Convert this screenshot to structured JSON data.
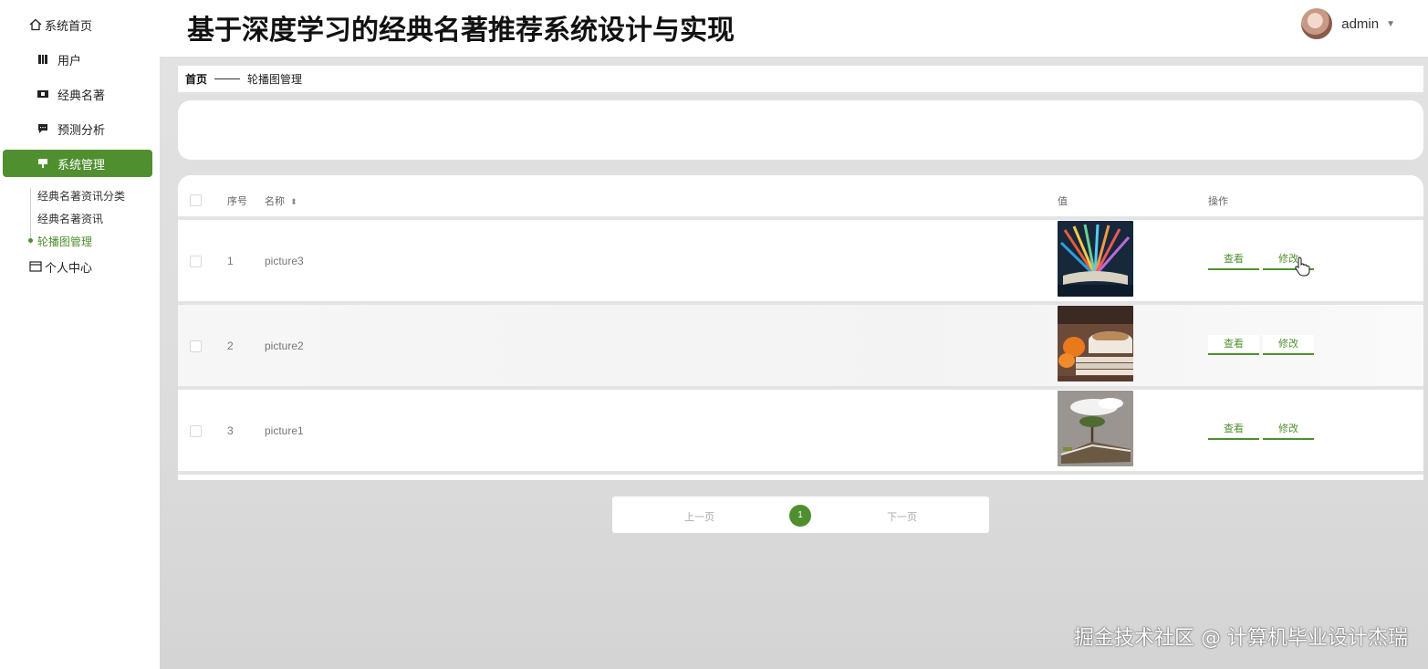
{
  "app_title": "基于深度学习的经典名著推荐系统设计与实现",
  "user": {
    "name": "admin"
  },
  "sidebar": {
    "items": [
      {
        "label": "系统首页",
        "icon": "home-icon"
      },
      {
        "label": "用户",
        "icon": "user-icon"
      },
      {
        "label": "经典名著",
        "icon": "book-icon"
      },
      {
        "label": "预测分析",
        "icon": "chart-icon"
      },
      {
        "label": "系统管理",
        "icon": "settings-icon",
        "active": true
      },
      {
        "label": "个人中心",
        "icon": "profile-icon"
      }
    ],
    "submenu": [
      {
        "label": "经典名著资讯分类"
      },
      {
        "label": "经典名著资讯"
      },
      {
        "label": "轮播图管理",
        "active": true
      }
    ]
  },
  "breadcrumb": {
    "home": "首页",
    "current": "轮播图管理"
  },
  "table": {
    "headers": {
      "index": "序号",
      "name": "名称",
      "value": "值",
      "actions": "操作"
    },
    "rows": [
      {
        "index": "1",
        "name": "picture3",
        "image": "colorful book pages"
      },
      {
        "index": "2",
        "name": "picture2",
        "image": "coffee cup on books with oranges"
      },
      {
        "index": "3",
        "name": "picture1",
        "image": "tree on open book with clouds"
      }
    ],
    "view_label": "查看",
    "edit_label": "修改"
  },
  "pagination": {
    "prev": "上一页",
    "next": "下一页",
    "current": "1"
  },
  "watermark": "掘金技术社区 @ 计算机毕业设计杰瑞",
  "colors": {
    "accent": "#4f8f2f"
  }
}
